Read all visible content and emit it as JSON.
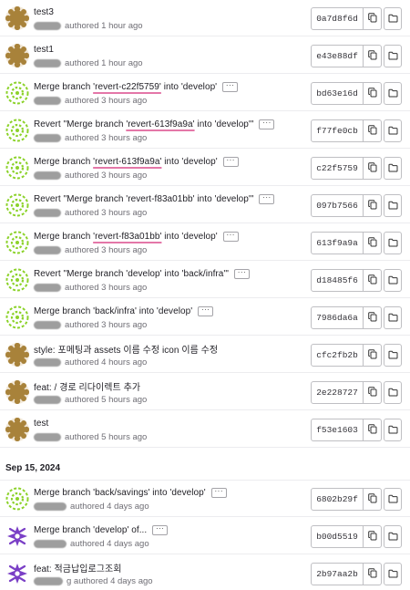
{
  "colors": {
    "highlight_underline": "#e477a8",
    "border": "#bfbfc3",
    "muted_text": "#6f6e75"
  },
  "icons": {
    "copy": "copy-icon",
    "browse": "folder-icon",
    "more": "ellipsis-icon"
  },
  "date_group": {
    "label": "Sep 15, 2024"
  },
  "commits": [
    {
      "title": "test3",
      "title_highlight": "",
      "title_after": "",
      "meta": "authored 1 hour ago",
      "sha": "0a7d8f6d",
      "has_ellipsis": false
    },
    {
      "title": "test1",
      "title_highlight": "",
      "title_after": "",
      "meta": "authored 1 hour ago",
      "sha": "e43e88df",
      "has_ellipsis": false
    },
    {
      "title": "Merge branch ",
      "title_highlight": "'revert-c22f5759'",
      "title_after": " into 'develop'",
      "meta": "authored 3 hours ago",
      "sha": "bd63e16d",
      "has_ellipsis": true
    },
    {
      "title": "Revert \"Merge branch ",
      "title_highlight": "'revert-613f9a9a'",
      "title_after": " into 'develop'\"",
      "meta": "authored 3 hours ago",
      "sha": "f77fe0cb",
      "has_ellipsis": true
    },
    {
      "title": "Merge branch ",
      "title_highlight": "'revert-613f9a9a'",
      "title_after": " into 'develop'",
      "meta": "authored 3 hours ago",
      "sha": "c22f5759",
      "has_ellipsis": true
    },
    {
      "title": "Revert \"Merge branch 'revert-f83a01bb' into 'develop'\"",
      "title_highlight": "",
      "title_after": "",
      "meta": "authored 3 hours ago",
      "sha": "097b7566",
      "has_ellipsis": true
    },
    {
      "title": "Merge branch ",
      "title_highlight": "'revert-f83a01bb'",
      "title_after": " into 'develop'",
      "meta": "authored 3 hours ago",
      "sha": "613f9a9a",
      "has_ellipsis": true
    },
    {
      "title": "Revert \"Merge branch 'develop' into 'back/infra'\"",
      "title_highlight": "",
      "title_after": "",
      "meta": "authored 3 hours ago",
      "sha": "d18485f6",
      "has_ellipsis": true
    },
    {
      "title": "Merge branch 'back/infra' into 'develop'",
      "title_highlight": "",
      "title_after": "",
      "meta": "authored 3 hours ago",
      "sha": "7986da6a",
      "has_ellipsis": true
    },
    {
      "title": "style: 포메팅과 assets 이름 수정 icon 이름 수정",
      "title_highlight": "",
      "title_after": "",
      "meta": "authored 4 hours ago",
      "sha": "cfc2fb2b",
      "has_ellipsis": false
    },
    {
      "title": "feat: / 경로 리다이렉트 추가",
      "title_highlight": "",
      "title_after": "",
      "meta": "authored 5 hours ago",
      "sha": "2e228727",
      "has_ellipsis": false
    },
    {
      "title": "test",
      "title_highlight": "",
      "title_after": "",
      "meta": "authored 5 hours ago",
      "sha": "f53e1603",
      "has_ellipsis": false
    },
    {
      "title": "Merge branch 'back/savings' into 'develop'",
      "title_highlight": "",
      "title_after": "",
      "meta": "authored 4 days ago",
      "sha": "6802b29f",
      "has_ellipsis": true
    },
    {
      "title": "Merge branch 'develop' of...",
      "title_highlight": "",
      "title_after": "",
      "meta": "authored 4 days ago",
      "sha": "b00d5519",
      "has_ellipsis": true
    },
    {
      "title": "feat: 적금납입로그조회",
      "title_highlight": "",
      "title_after": "",
      "meta": "g authored 4 days ago",
      "sha": "2b97aa2b",
      "has_ellipsis": false
    }
  ]
}
